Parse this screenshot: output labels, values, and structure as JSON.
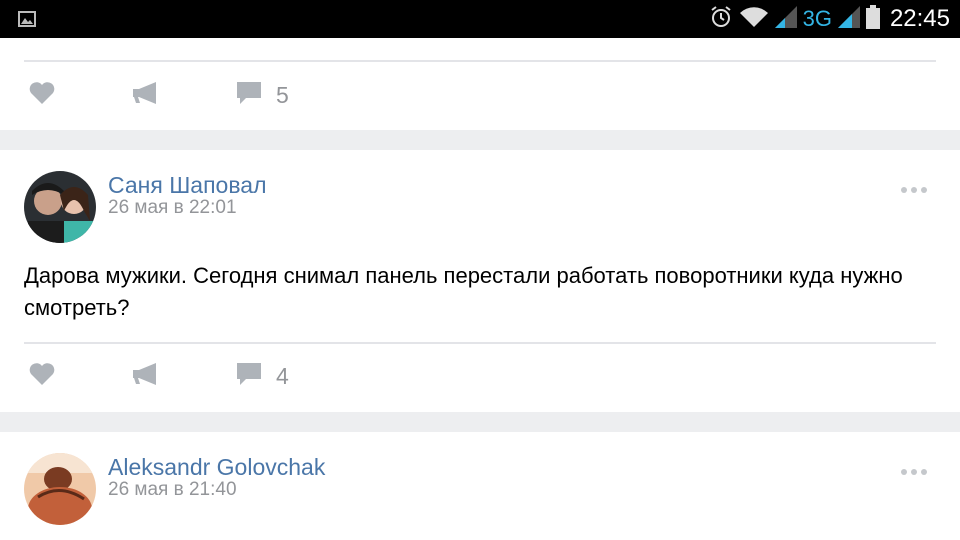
{
  "status_bar": {
    "network": "3G",
    "time": "22:45"
  },
  "posts": [
    {
      "comments_count": "5"
    },
    {
      "author": "Саня Шаповал",
      "date": "26 мая в 22:01",
      "text": "Дарова мужики. Сегодня снимал панель перестали работать поворотники куда нужно смотреть?",
      "comments_count": "4"
    },
    {
      "author": "Aleksandr Golovchak",
      "date": "26 мая в 21:40"
    }
  ],
  "colors": {
    "author_link": "#4a76a8",
    "meta_gray": "#939599",
    "network_accent": "#33b5e5",
    "feed_background": "#edeef0"
  }
}
